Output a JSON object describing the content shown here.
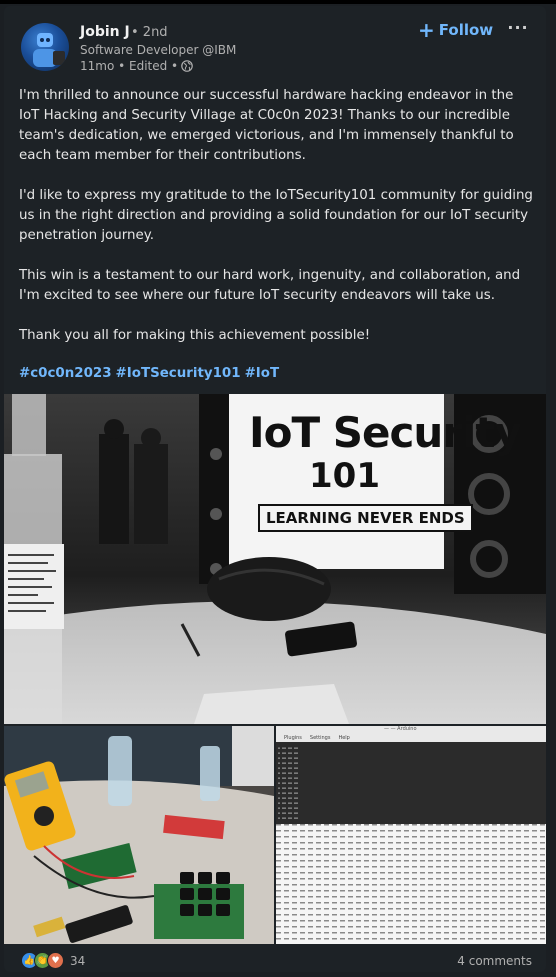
{
  "author": {
    "name": "Jobin J",
    "degree": "• 2nd",
    "headline": "Software Developer @IBM",
    "time": "11mo • Edited •"
  },
  "actions": {
    "follow_label": "Follow",
    "more_label": "···"
  },
  "post": {
    "paragraphs": [
      "I'm thrilled to announce our successful hardware hacking endeavor in the IoT Hacking and Security Village at C0c0n 2023! Thanks to our incredible team's dedication, we emerged victorious, and I'm immensely thankful to each team member for their contributions.",
      "I'd like to express my gratitude to the IoTSecurity101 community for guiding us in the right direction and providing a solid foundation for our IoT security penetration journey.",
      "This win is a testament to our hard work, ingenuity, and collaboration, and I'm excited to see where our future IoT security endeavors will take us.",
      "Thank you all for making this achievement possible!"
    ],
    "hashtags": [
      "#c0c0n2023",
      "#IoTSecurity101",
      "#IoT"
    ]
  },
  "images": {
    "main": {
      "slide_title": "IoT Security",
      "slide_number": "101",
      "slide_tagline": "LEARNING NEVER ENDS"
    },
    "screen_menu": [
      "Plugins",
      "Settings",
      "Help"
    ],
    "screen_window_title": "— — Arduino"
  },
  "social": {
    "reaction_count": "34",
    "comments": "4 comments"
  },
  "colors": {
    "background": "#1d2226",
    "link": "#71b7fb",
    "text": "#e6e6e6",
    "muted": "#b0b0b0"
  }
}
